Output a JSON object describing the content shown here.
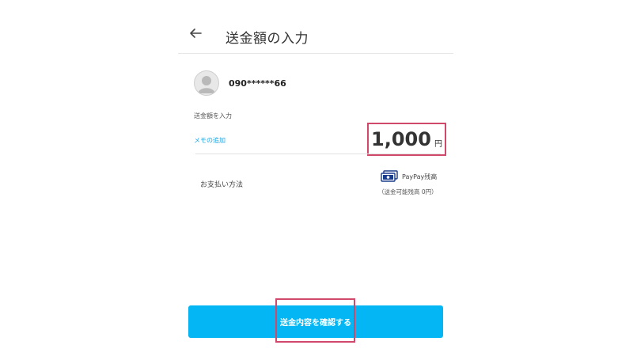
{
  "header": {
    "title": "送金額の入力",
    "back_icon": "arrow-left-icon"
  },
  "recipient": {
    "avatar_icon": "user-avatar-icon",
    "phone": "090******66"
  },
  "amount": {
    "label": "送金額を入力",
    "value": "1,000",
    "unit": "円"
  },
  "memo": {
    "link_label": "メモの追加"
  },
  "payment": {
    "label": "お支払い方法",
    "method_icon": "paypay-balance-icon",
    "method_name": "PayPay残高",
    "available": "（送金可能残高 0円）"
  },
  "confirm": {
    "label": "送金内容を確認する"
  },
  "colors": {
    "accent": "#04b7f4",
    "link": "#1ea6e6",
    "highlight": "#d0486a"
  }
}
